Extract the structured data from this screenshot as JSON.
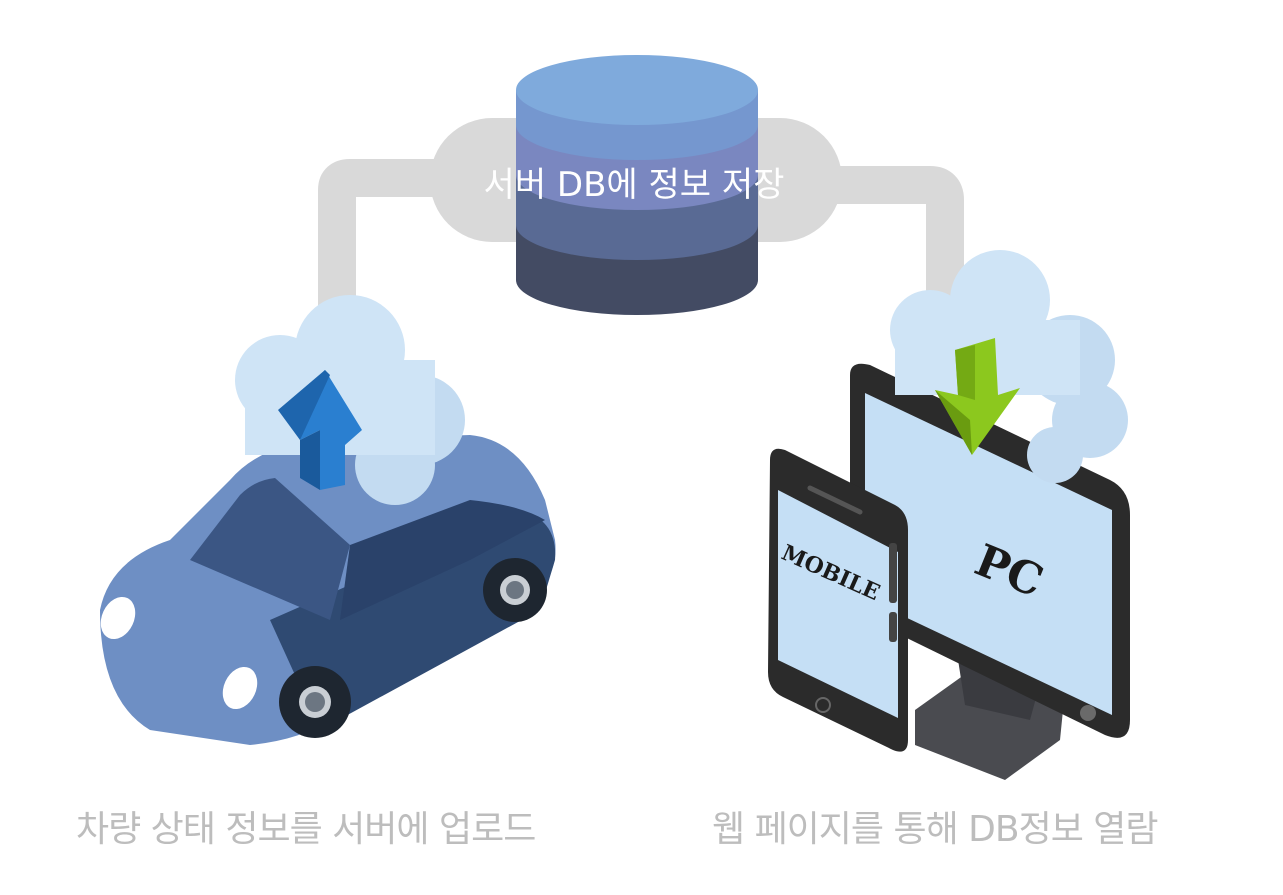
{
  "server": {
    "label": "서버 DB에 정보 저장"
  },
  "car": {
    "caption": "차량 상태 정보를 서버에 업로드"
  },
  "devices": {
    "mobile_label": "MOBILE",
    "pc_label": "PC",
    "caption": "웹 페이지를 통해 DB정보 열람"
  },
  "colors": {
    "connector": "#d9d9d9",
    "db_top": "#7faadc",
    "db_mid": "#7a87c0",
    "db_low": "#596a94",
    "db_bottom": "#434b63",
    "car_body": "#6e8fc4",
    "car_dark": "#2f4a72",
    "cloud": "#cfe4f6",
    "upload_arrow": "#2a7fd0",
    "download_arrow": "#8cc81e",
    "device_frame": "#2b2b2b",
    "screen": "#c5dff5",
    "caption_text": "#bdbdbd"
  }
}
